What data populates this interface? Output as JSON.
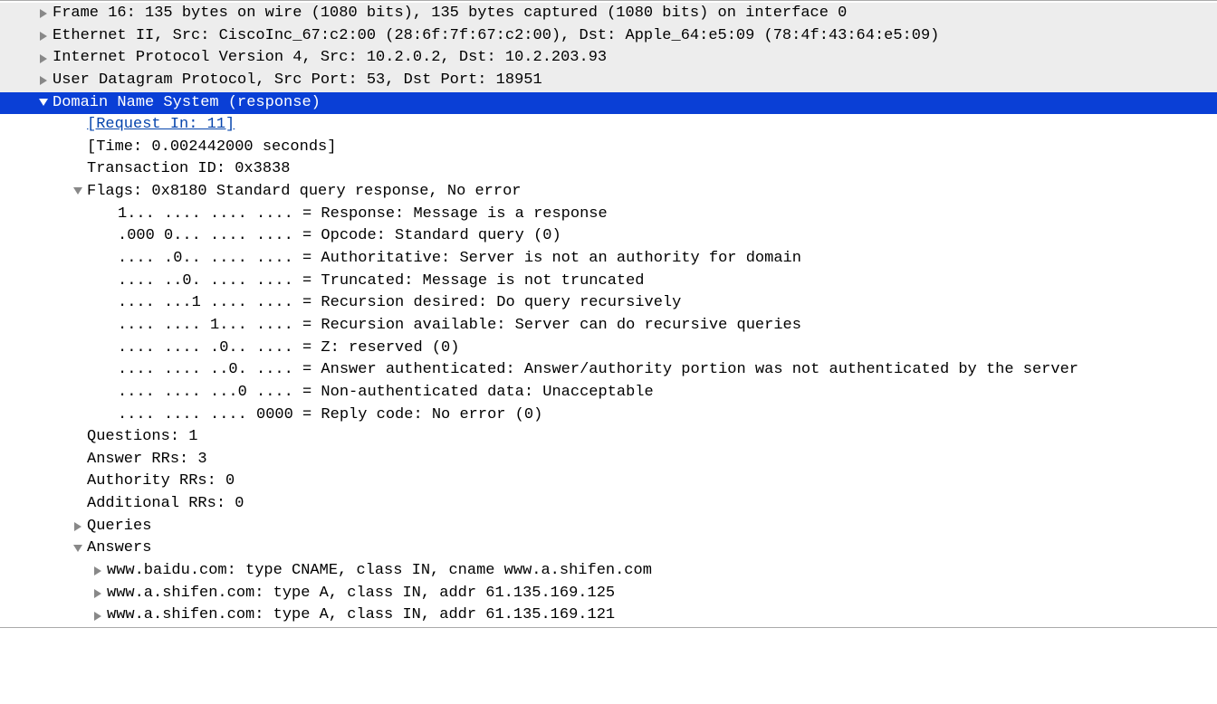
{
  "colors": {
    "selected_bg": "#0a3fd6",
    "header_bg": "#ededed",
    "link": "#0645ad",
    "triangle": "#888888"
  },
  "protocol_rows": [
    "Frame 16: 135 bytes on wire (1080 bits), 135 bytes captured (1080 bits) on interface 0",
    "Ethernet II, Src: CiscoInc_67:c2:00 (28:6f:7f:67:c2:00), Dst: Apple_64:e5:09 (78:4f:43:64:e5:09)",
    "Internet Protocol Version 4, Src: 10.2.0.2, Dst: 10.2.203.93",
    "User Datagram Protocol, Src Port: 53, Dst Port: 18951"
  ],
  "dns": {
    "title": "Domain Name System (response)",
    "request_in": "[Request In: 11]",
    "time": "[Time: 0.002442000 seconds]",
    "transaction_id": "Transaction ID: 0x3838",
    "flags_header": "Flags: 0x8180 Standard query response, No error",
    "flags": [
      "1... .... .... .... = Response: Message is a response",
      ".000 0... .... .... = Opcode: Standard query (0)",
      ".... .0.. .... .... = Authoritative: Server is not an authority for domain",
      ".... ..0. .... .... = Truncated: Message is not truncated",
      ".... ...1 .... .... = Recursion desired: Do query recursively",
      ".... .... 1... .... = Recursion available: Server can do recursive queries",
      ".... .... .0.. .... = Z: reserved (0)",
      ".... .... ..0. .... = Answer authenticated: Answer/authority portion was not authenticated by the server",
      ".... .... ...0 .... = Non-authenticated data: Unacceptable",
      ".... .... .... 0000 = Reply code: No error (0)"
    ],
    "questions": "Questions: 1",
    "answer_rrs": "Answer RRs: 3",
    "authority_rrs": "Authority RRs: 0",
    "additional_rrs": "Additional RRs: 0",
    "queries_label": "Queries",
    "answers_label": "Answers",
    "answers": [
      "www.baidu.com: type CNAME, class IN, cname www.a.shifen.com",
      "www.a.shifen.com: type A, class IN, addr 61.135.169.125",
      "www.a.shifen.com: type A, class IN, addr 61.135.169.121"
    ]
  }
}
